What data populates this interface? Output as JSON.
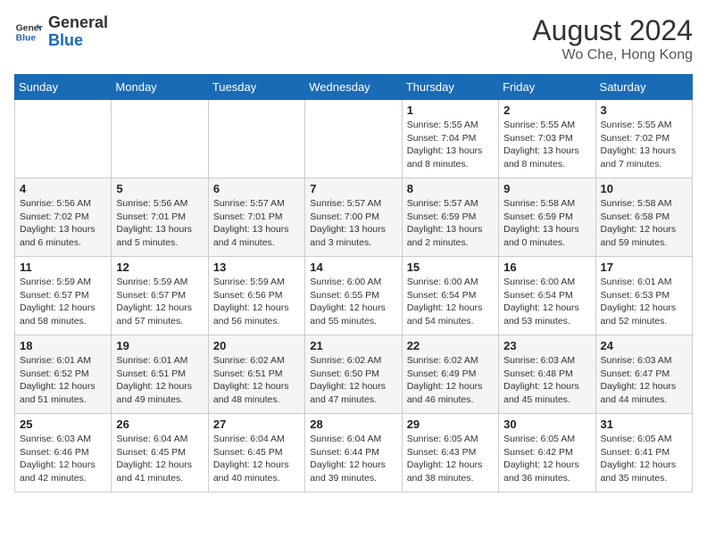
{
  "header": {
    "logo_line1": "General",
    "logo_line2": "Blue",
    "title": "August 2024",
    "subtitle": "Wo Che, Hong Kong"
  },
  "days_of_week": [
    "Sunday",
    "Monday",
    "Tuesday",
    "Wednesday",
    "Thursday",
    "Friday",
    "Saturday"
  ],
  "weeks": [
    [
      {
        "day": "",
        "info": ""
      },
      {
        "day": "",
        "info": ""
      },
      {
        "day": "",
        "info": ""
      },
      {
        "day": "",
        "info": ""
      },
      {
        "day": "1",
        "info": "Sunrise: 5:55 AM\nSunset: 7:04 PM\nDaylight: 13 hours\nand 8 minutes."
      },
      {
        "day": "2",
        "info": "Sunrise: 5:55 AM\nSunset: 7:03 PM\nDaylight: 13 hours\nand 8 minutes."
      },
      {
        "day": "3",
        "info": "Sunrise: 5:55 AM\nSunset: 7:02 PM\nDaylight: 13 hours\nand 7 minutes."
      }
    ],
    [
      {
        "day": "4",
        "info": "Sunrise: 5:56 AM\nSunset: 7:02 PM\nDaylight: 13 hours\nand 6 minutes."
      },
      {
        "day": "5",
        "info": "Sunrise: 5:56 AM\nSunset: 7:01 PM\nDaylight: 13 hours\nand 5 minutes."
      },
      {
        "day": "6",
        "info": "Sunrise: 5:57 AM\nSunset: 7:01 PM\nDaylight: 13 hours\nand 4 minutes."
      },
      {
        "day": "7",
        "info": "Sunrise: 5:57 AM\nSunset: 7:00 PM\nDaylight: 13 hours\nand 3 minutes."
      },
      {
        "day": "8",
        "info": "Sunrise: 5:57 AM\nSunset: 6:59 PM\nDaylight: 13 hours\nand 2 minutes."
      },
      {
        "day": "9",
        "info": "Sunrise: 5:58 AM\nSunset: 6:59 PM\nDaylight: 13 hours\nand 0 minutes."
      },
      {
        "day": "10",
        "info": "Sunrise: 5:58 AM\nSunset: 6:58 PM\nDaylight: 12 hours\nand 59 minutes."
      }
    ],
    [
      {
        "day": "11",
        "info": "Sunrise: 5:59 AM\nSunset: 6:57 PM\nDaylight: 12 hours\nand 58 minutes."
      },
      {
        "day": "12",
        "info": "Sunrise: 5:59 AM\nSunset: 6:57 PM\nDaylight: 12 hours\nand 57 minutes."
      },
      {
        "day": "13",
        "info": "Sunrise: 5:59 AM\nSunset: 6:56 PM\nDaylight: 12 hours\nand 56 minutes."
      },
      {
        "day": "14",
        "info": "Sunrise: 6:00 AM\nSunset: 6:55 PM\nDaylight: 12 hours\nand 55 minutes."
      },
      {
        "day": "15",
        "info": "Sunrise: 6:00 AM\nSunset: 6:54 PM\nDaylight: 12 hours\nand 54 minutes."
      },
      {
        "day": "16",
        "info": "Sunrise: 6:00 AM\nSunset: 6:54 PM\nDaylight: 12 hours\nand 53 minutes."
      },
      {
        "day": "17",
        "info": "Sunrise: 6:01 AM\nSunset: 6:53 PM\nDaylight: 12 hours\nand 52 minutes."
      }
    ],
    [
      {
        "day": "18",
        "info": "Sunrise: 6:01 AM\nSunset: 6:52 PM\nDaylight: 12 hours\nand 51 minutes."
      },
      {
        "day": "19",
        "info": "Sunrise: 6:01 AM\nSunset: 6:51 PM\nDaylight: 12 hours\nand 49 minutes."
      },
      {
        "day": "20",
        "info": "Sunrise: 6:02 AM\nSunset: 6:51 PM\nDaylight: 12 hours\nand 48 minutes."
      },
      {
        "day": "21",
        "info": "Sunrise: 6:02 AM\nSunset: 6:50 PM\nDaylight: 12 hours\nand 47 minutes."
      },
      {
        "day": "22",
        "info": "Sunrise: 6:02 AM\nSunset: 6:49 PM\nDaylight: 12 hours\nand 46 minutes."
      },
      {
        "day": "23",
        "info": "Sunrise: 6:03 AM\nSunset: 6:48 PM\nDaylight: 12 hours\nand 45 minutes."
      },
      {
        "day": "24",
        "info": "Sunrise: 6:03 AM\nSunset: 6:47 PM\nDaylight: 12 hours\nand 44 minutes."
      }
    ],
    [
      {
        "day": "25",
        "info": "Sunrise: 6:03 AM\nSunset: 6:46 PM\nDaylight: 12 hours\nand 42 minutes."
      },
      {
        "day": "26",
        "info": "Sunrise: 6:04 AM\nSunset: 6:45 PM\nDaylight: 12 hours\nand 41 minutes."
      },
      {
        "day": "27",
        "info": "Sunrise: 6:04 AM\nSunset: 6:45 PM\nDaylight: 12 hours\nand 40 minutes."
      },
      {
        "day": "28",
        "info": "Sunrise: 6:04 AM\nSunset: 6:44 PM\nDaylight: 12 hours\nand 39 minutes."
      },
      {
        "day": "29",
        "info": "Sunrise: 6:05 AM\nSunset: 6:43 PM\nDaylight: 12 hours\nand 38 minutes."
      },
      {
        "day": "30",
        "info": "Sunrise: 6:05 AM\nSunset: 6:42 PM\nDaylight: 12 hours\nand 36 minutes."
      },
      {
        "day": "31",
        "info": "Sunrise: 6:05 AM\nSunset: 6:41 PM\nDaylight: 12 hours\nand 35 minutes."
      }
    ]
  ]
}
